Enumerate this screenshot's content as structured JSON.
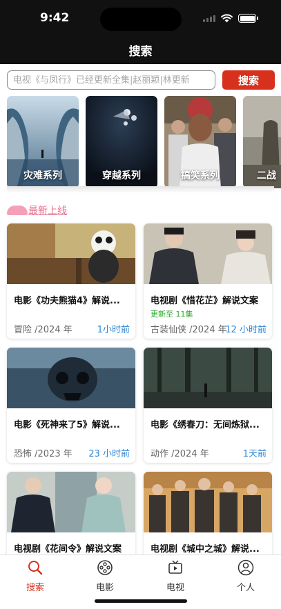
{
  "status_bar": {
    "time": "9:42"
  },
  "header": {
    "title": "搜索"
  },
  "search": {
    "placeholder": "电视《与凤行》已经更新全集|赵丽颖|林更新",
    "button_label": "搜索"
  },
  "categories": [
    {
      "label": "灾难系列",
      "icon": "disaster-poster"
    },
    {
      "label": "穿越系列",
      "icon": "time-travel-poster"
    },
    {
      "label": "搞笑系列",
      "icon": "comedy-poster"
    },
    {
      "label": "二战",
      "icon": "ww2-poster"
    }
  ],
  "section": {
    "title": "最新上线"
  },
  "cards": [
    {
      "title": "电影《功夫熊猫4》解说...",
      "update": "",
      "meta": "冒险 /2024 年",
      "time": "1小时前"
    },
    {
      "title": "电视剧《惜花芷》解说文案",
      "update": "更新至 11集",
      "meta": "古装仙侠 /2024 年",
      "time": "12 小时前"
    },
    {
      "title": "电影《死神来了5》解说...",
      "update": "",
      "meta": "恐怖 /2023 年",
      "time": "23 小时前"
    },
    {
      "title": "电影《绣春刀：无间炼狱...",
      "update": "",
      "meta": "动作 /2024 年",
      "time": "1天前"
    },
    {
      "title": "电视剧《花间令》解说文案",
      "update": "",
      "meta": "",
      "time": ""
    },
    {
      "title": "电视剧《城中之城》解说...",
      "update": "",
      "meta": "",
      "time": ""
    }
  ],
  "tabbar": [
    {
      "label": "搜索",
      "icon": "search-icon",
      "active": true
    },
    {
      "label": "电影",
      "icon": "film-reel-icon",
      "active": false
    },
    {
      "label": "电视",
      "icon": "tv-icon",
      "active": false
    },
    {
      "label": "个人",
      "icon": "person-icon",
      "active": false
    }
  ],
  "colors": {
    "accent": "#d7301c",
    "section": "#e56f8f",
    "time_blue": "#2f86d6",
    "update_green": "#2faa2f"
  }
}
